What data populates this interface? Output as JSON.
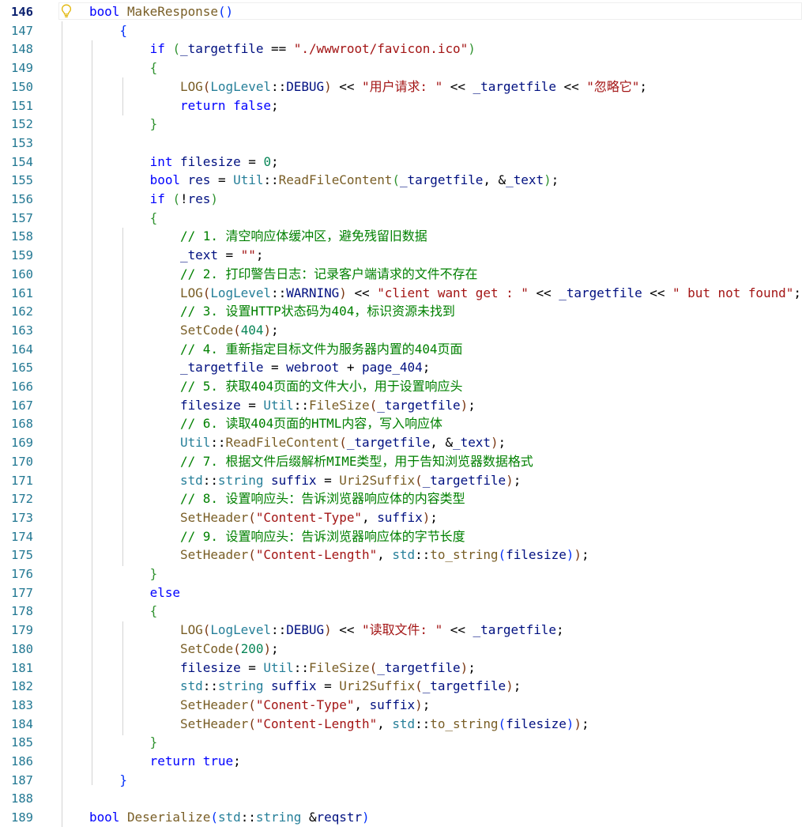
{
  "editor": {
    "first_line_number": 146,
    "current_line_number": 146,
    "colors": {
      "keyword": "#0000ff",
      "type": "#267f99",
      "function": "#795e26",
      "variable": "#001080",
      "string": "#a31515",
      "number": "#098658",
      "comment": "#008000",
      "bracket_level1": "#0431fa",
      "bracket_level2": "#319331",
      "bracket_level3": "#7b3814",
      "line_number": "#237893"
    },
    "lines": [
      [
        [
          "kw",
          "bool"
        ],
        [
          "op",
          " "
        ],
        [
          "fn",
          "MakeResponse"
        ],
        [
          "b1",
          "()"
        ]
      ],
      [
        [
          "op",
          "    "
        ],
        [
          "b1",
          "{"
        ]
      ],
      [
        [
          "op",
          "        "
        ],
        [
          "kw",
          "if"
        ],
        [
          "op",
          " "
        ],
        [
          "b2",
          "("
        ],
        [
          "va",
          "_targetfile"
        ],
        [
          "op",
          " == "
        ],
        [
          "st",
          "\"./wwwroot/favicon.ico\""
        ],
        [
          "b2",
          ")"
        ]
      ],
      [
        [
          "op",
          "        "
        ],
        [
          "b2",
          "{"
        ]
      ],
      [
        [
          "op",
          "            "
        ],
        [
          "fn",
          "LOG"
        ],
        [
          "b3",
          "("
        ],
        [
          "ty",
          "LogLevel"
        ],
        [
          "op",
          "::"
        ],
        [
          "va",
          "DEBUG"
        ],
        [
          "b3",
          ")"
        ],
        [
          "op",
          " << "
        ],
        [
          "st",
          "\"用户请求: \""
        ],
        [
          "op",
          " << "
        ],
        [
          "va",
          "_targetfile"
        ],
        [
          "op",
          " << "
        ],
        [
          "st",
          "\"忽略它\""
        ],
        [
          "op",
          ";"
        ]
      ],
      [
        [
          "op",
          "            "
        ],
        [
          "kw",
          "return"
        ],
        [
          "op",
          " "
        ],
        [
          "kw",
          "false"
        ],
        [
          "op",
          ";"
        ]
      ],
      [
        [
          "op",
          "        "
        ],
        [
          "b2",
          "}"
        ]
      ],
      [],
      [
        [
          "op",
          "        "
        ],
        [
          "kw",
          "int"
        ],
        [
          "op",
          " "
        ],
        [
          "va",
          "filesize"
        ],
        [
          "op",
          " = "
        ],
        [
          "nu",
          "0"
        ],
        [
          "op",
          ";"
        ]
      ],
      [
        [
          "op",
          "        "
        ],
        [
          "kw",
          "bool"
        ],
        [
          "op",
          " "
        ],
        [
          "va",
          "res"
        ],
        [
          "op",
          " = "
        ],
        [
          "ty",
          "Util"
        ],
        [
          "op",
          "::"
        ],
        [
          "fn",
          "ReadFileContent"
        ],
        [
          "b2",
          "("
        ],
        [
          "va",
          "_targetfile"
        ],
        [
          "op",
          ", &"
        ],
        [
          "va",
          "_text"
        ],
        [
          "b2",
          ")"
        ],
        [
          "op",
          ";"
        ]
      ],
      [
        [
          "op",
          "        "
        ],
        [
          "kw",
          "if"
        ],
        [
          "op",
          " "
        ],
        [
          "b2",
          "("
        ],
        [
          "op",
          "!"
        ],
        [
          "va",
          "res"
        ],
        [
          "b2",
          ")"
        ]
      ],
      [
        [
          "op",
          "        "
        ],
        [
          "b2",
          "{"
        ]
      ],
      [
        [
          "op",
          "            "
        ],
        [
          "cm",
          "// 1. 清空响应体缓冲区，避免残留旧数据"
        ]
      ],
      [
        [
          "op",
          "            "
        ],
        [
          "va",
          "_text"
        ],
        [
          "op",
          " = "
        ],
        [
          "st",
          "\"\""
        ],
        [
          "op",
          ";"
        ]
      ],
      [
        [
          "op",
          "            "
        ],
        [
          "cm",
          "// 2. 打印警告日志：记录客户端请求的文件不存在"
        ]
      ],
      [
        [
          "op",
          "            "
        ],
        [
          "fn",
          "LOG"
        ],
        [
          "b3",
          "("
        ],
        [
          "ty",
          "LogLevel"
        ],
        [
          "op",
          "::"
        ],
        [
          "va",
          "WARNING"
        ],
        [
          "b3",
          ")"
        ],
        [
          "op",
          " << "
        ],
        [
          "st",
          "\"client want get : \""
        ],
        [
          "op",
          " << "
        ],
        [
          "va",
          "_targetfile"
        ],
        [
          "op",
          " << "
        ],
        [
          "st",
          "\" but not found\""
        ],
        [
          "op",
          ";"
        ]
      ],
      [
        [
          "op",
          "            "
        ],
        [
          "cm",
          "// 3. 设置HTTP状态码为404，标识资源未找到"
        ]
      ],
      [
        [
          "op",
          "            "
        ],
        [
          "fn",
          "SetCode"
        ],
        [
          "b3",
          "("
        ],
        [
          "nu",
          "404"
        ],
        [
          "b3",
          ")"
        ],
        [
          "op",
          ";"
        ]
      ],
      [
        [
          "op",
          "            "
        ],
        [
          "cm",
          "// 4. 重新指定目标文件为服务器内置的404页面"
        ]
      ],
      [
        [
          "op",
          "            "
        ],
        [
          "va",
          "_targetfile"
        ],
        [
          "op",
          " = "
        ],
        [
          "va",
          "webroot"
        ],
        [
          "op",
          " + "
        ],
        [
          "va",
          "page_404"
        ],
        [
          "op",
          ";"
        ]
      ],
      [
        [
          "op",
          "            "
        ],
        [
          "cm",
          "// 5. 获取404页面的文件大小，用于设置响应头"
        ]
      ],
      [
        [
          "op",
          "            "
        ],
        [
          "va",
          "filesize"
        ],
        [
          "op",
          " = "
        ],
        [
          "ty",
          "Util"
        ],
        [
          "op",
          "::"
        ],
        [
          "fn",
          "FileSize"
        ],
        [
          "b3",
          "("
        ],
        [
          "va",
          "_targetfile"
        ],
        [
          "b3",
          ")"
        ],
        [
          "op",
          ";"
        ]
      ],
      [
        [
          "op",
          "            "
        ],
        [
          "cm",
          "// 6. 读取404页面的HTML内容，写入响应体"
        ]
      ],
      [
        [
          "op",
          "            "
        ],
        [
          "ty",
          "Util"
        ],
        [
          "op",
          "::"
        ],
        [
          "fn",
          "ReadFileContent"
        ],
        [
          "b3",
          "("
        ],
        [
          "va",
          "_targetfile"
        ],
        [
          "op",
          ", &"
        ],
        [
          "va",
          "_text"
        ],
        [
          "b3",
          ")"
        ],
        [
          "op",
          ";"
        ]
      ],
      [
        [
          "op",
          "            "
        ],
        [
          "cm",
          "// 7. 根据文件后缀解析MIME类型，用于告知浏览器数据格式"
        ]
      ],
      [
        [
          "op",
          "            "
        ],
        [
          "ty",
          "std"
        ],
        [
          "op",
          "::"
        ],
        [
          "ty",
          "string"
        ],
        [
          "op",
          " "
        ],
        [
          "va",
          "suffix"
        ],
        [
          "op",
          " = "
        ],
        [
          "fn",
          "Uri2Suffix"
        ],
        [
          "b3",
          "("
        ],
        [
          "va",
          "_targetfile"
        ],
        [
          "b3",
          ")"
        ],
        [
          "op",
          ";"
        ]
      ],
      [
        [
          "op",
          "            "
        ],
        [
          "cm",
          "// 8. 设置响应头：告诉浏览器响应体的内容类型"
        ]
      ],
      [
        [
          "op",
          "            "
        ],
        [
          "fn",
          "SetHeader"
        ],
        [
          "b3",
          "("
        ],
        [
          "st",
          "\"Content-Type\""
        ],
        [
          "op",
          ", "
        ],
        [
          "va",
          "suffix"
        ],
        [
          "b3",
          ")"
        ],
        [
          "op",
          ";"
        ]
      ],
      [
        [
          "op",
          "            "
        ],
        [
          "cm",
          "// 9. 设置响应头：告诉浏览器响应体的字节长度"
        ]
      ],
      [
        [
          "op",
          "            "
        ],
        [
          "fn",
          "SetHeader"
        ],
        [
          "b3",
          "("
        ],
        [
          "st",
          "\"Content-Length\""
        ],
        [
          "op",
          ", "
        ],
        [
          "ty",
          "std"
        ],
        [
          "op",
          "::"
        ],
        [
          "fn",
          "to_string"
        ],
        [
          "b1",
          "("
        ],
        [
          "va",
          "filesize"
        ],
        [
          "b1",
          ")"
        ],
        [
          "b3",
          ")"
        ],
        [
          "op",
          ";"
        ]
      ],
      [
        [
          "op",
          "        "
        ],
        [
          "b2",
          "}"
        ]
      ],
      [
        [
          "op",
          "        "
        ],
        [
          "kw",
          "else"
        ]
      ],
      [
        [
          "op",
          "        "
        ],
        [
          "b2",
          "{"
        ]
      ],
      [
        [
          "op",
          "            "
        ],
        [
          "fn",
          "LOG"
        ],
        [
          "b3",
          "("
        ],
        [
          "ty",
          "LogLevel"
        ],
        [
          "op",
          "::"
        ],
        [
          "va",
          "DEBUG"
        ],
        [
          "b3",
          ")"
        ],
        [
          "op",
          " << "
        ],
        [
          "st",
          "\"读取文件: \""
        ],
        [
          "op",
          " << "
        ],
        [
          "va",
          "_targetfile"
        ],
        [
          "op",
          ";"
        ]
      ],
      [
        [
          "op",
          "            "
        ],
        [
          "fn",
          "SetCode"
        ],
        [
          "b3",
          "("
        ],
        [
          "nu",
          "200"
        ],
        [
          "b3",
          ")"
        ],
        [
          "op",
          ";"
        ]
      ],
      [
        [
          "op",
          "            "
        ],
        [
          "va",
          "filesize"
        ],
        [
          "op",
          " = "
        ],
        [
          "ty",
          "Util"
        ],
        [
          "op",
          "::"
        ],
        [
          "fn",
          "FileSize"
        ],
        [
          "b3",
          "("
        ],
        [
          "va",
          "_targetfile"
        ],
        [
          "b3",
          ")"
        ],
        [
          "op",
          ";"
        ]
      ],
      [
        [
          "op",
          "            "
        ],
        [
          "ty",
          "std"
        ],
        [
          "op",
          "::"
        ],
        [
          "ty",
          "string"
        ],
        [
          "op",
          " "
        ],
        [
          "va",
          "suffix"
        ],
        [
          "op",
          " = "
        ],
        [
          "fn",
          "Uri2Suffix"
        ],
        [
          "b3",
          "("
        ],
        [
          "va",
          "_targetfile"
        ],
        [
          "b3",
          ")"
        ],
        [
          "op",
          ";"
        ]
      ],
      [
        [
          "op",
          "            "
        ],
        [
          "fn",
          "SetHeader"
        ],
        [
          "b3",
          "("
        ],
        [
          "st",
          "\"Conent-Type\""
        ],
        [
          "op",
          ", "
        ],
        [
          "va",
          "suffix"
        ],
        [
          "b3",
          ")"
        ],
        [
          "op",
          ";"
        ]
      ],
      [
        [
          "op",
          "            "
        ],
        [
          "fn",
          "SetHeader"
        ],
        [
          "b3",
          "("
        ],
        [
          "st",
          "\"Content-Length\""
        ],
        [
          "op",
          ", "
        ],
        [
          "ty",
          "std"
        ],
        [
          "op",
          "::"
        ],
        [
          "fn",
          "to_string"
        ],
        [
          "b1",
          "("
        ],
        [
          "va",
          "filesize"
        ],
        [
          "b1",
          ")"
        ],
        [
          "b3",
          ")"
        ],
        [
          "op",
          ";"
        ]
      ],
      [
        [
          "op",
          "        "
        ],
        [
          "b2",
          "}"
        ]
      ],
      [
        [
          "op",
          "        "
        ],
        [
          "kw",
          "return"
        ],
        [
          "op",
          " "
        ],
        [
          "kw",
          "true"
        ],
        [
          "op",
          ";"
        ]
      ],
      [
        [
          "op",
          "    "
        ],
        [
          "b1",
          "}"
        ]
      ],
      [],
      [
        [
          "kw",
          "bool"
        ],
        [
          "op",
          " "
        ],
        [
          "fn",
          "Deserialize"
        ],
        [
          "b1",
          "("
        ],
        [
          "ty",
          "std"
        ],
        [
          "op",
          "::"
        ],
        [
          "ty",
          "string"
        ],
        [
          "op",
          " &"
        ],
        [
          "va",
          "reqstr"
        ],
        [
          "b1",
          ")"
        ]
      ]
    ]
  }
}
